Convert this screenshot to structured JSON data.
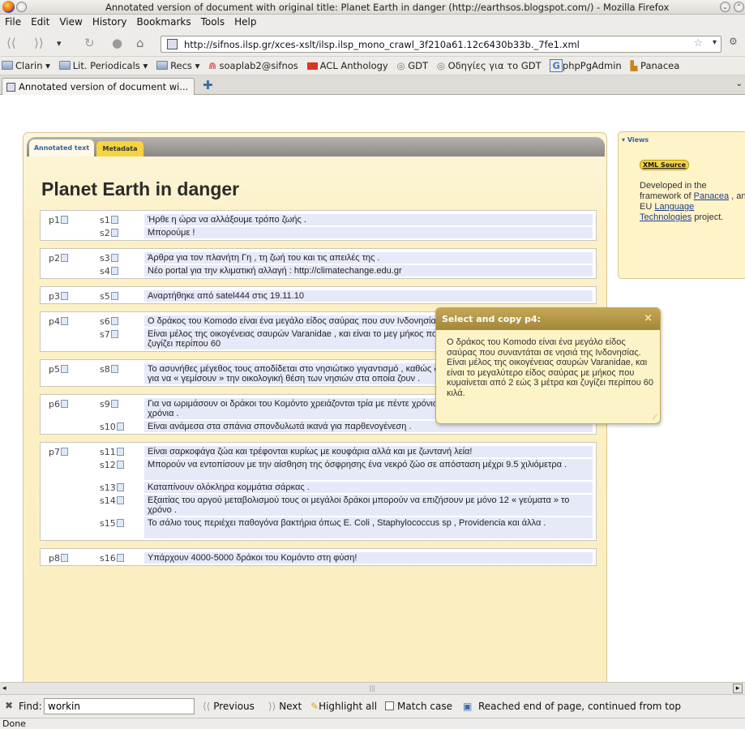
{
  "window": {
    "title": "Annotated version of document with original title: Planet Earth in danger (http://earthsos.blogspot.com/) - Mozilla Firefox"
  },
  "menu": [
    "File",
    "Edit",
    "View",
    "History",
    "Bookmarks",
    "Tools",
    "Help"
  ],
  "url": "http://sifnos.ilsp.gr/xces-xslt/ilsp.ilsp_mono_crawl_3f210a61.12c6430b33b._7fe1.xml",
  "bookmarks": [
    "Clarin",
    "Lit. Periodicals",
    "Recs",
    "soaplab2@sifnos",
    "ACL Anthology",
    "GDT",
    "Οδηγίες για το GDT",
    "phpPgAdmin",
    "Panacea"
  ],
  "tab": {
    "title": "Annotated version of document wi..."
  },
  "page": {
    "tabs": {
      "annotated": "Annotated text",
      "metadata": "Metadata"
    },
    "title": "Planet Earth in danger",
    "paragraphs": [
      {
        "label": "p1",
        "sentences": [
          {
            "label": "s1",
            "text": "Ήρθε η ώρα να αλλάξουμε τρόπο ζωής ."
          },
          {
            "label": "s2",
            "text": "Μπορούμε !"
          }
        ]
      },
      {
        "label": "p2",
        "sentences": [
          {
            "label": "s3",
            "text": "Άρθρα για τον πλανήτη Γη , τη ζωή του και τις απειλές της ."
          },
          {
            "label": "s4",
            "text": "Νέο portal για την κλιματική αλλαγή : http://climatechange.edu.gr"
          }
        ]
      },
      {
        "label": "p3",
        "sentences": [
          {
            "label": "s5",
            "text": "Αναρτήθηκε από satel444 στις 19.11.10"
          }
        ]
      },
      {
        "label": "p4",
        "sentences": [
          {
            "label": "s6",
            "text": "Ο δράκος του Komodo είναι ένα μεγάλο είδος σαύρας που συν Ινδονησίας ."
          },
          {
            "label": "s7",
            "text": "Είναι μέλος της οικογένειας σαυρών Varanidae , και είναι το μεγ μήκος που κυμαίνεται από 2 εώς 3 μέτρα και ζυγίζει περίπου 60"
          }
        ]
      },
      {
        "label": "p5",
        "sentences": [
          {
            "label": "s8",
            "text": "Το ασυνήθες μέγεθος τους αποδίδεται στο νησιώτικο γιγαντισμό , καθώς δεν υπάρχουν άλλα σαρκοφάγα ζώα για να « γεμίσουν » την οικολογική θέση των νησιών στα οποία ζουν ."
          }
        ]
      },
      {
        "label": "p6",
        "sentences": [
          {
            "label": "s9",
            "text": "Για να ωριμάσουν οι δράκοι του Κομόντο χρειάζονται τρία με πέντε χρόνια ενώ μπορούν να ζήσουν εώς και 50 χρόνια ."
          },
          {
            "label": "s10",
            "text": "Είναι ανάμεσα στα σπάνια σπονδυλωτά ικανά για παρθενογένεση ."
          }
        ]
      },
      {
        "label": "p7",
        "sentences": [
          {
            "label": "s11",
            "text": "Είναι σαρκοφάγα ζώα και τρέφονται κυρίως με κουφάρια αλλά και με ζωντανή λεία!"
          },
          {
            "label": "s12",
            "text": "Μπορούν να εντοπίσουν με την αίσθηση της όσφρησης ένα νεκρό ζώο σε απόσταση μέχρι 9.5 χιλιόμετρα ."
          },
          {
            "label": "s13",
            "text": "Καταπίνουν ολόκληρα κομμάτια σάρκας ."
          },
          {
            "label": "s14",
            "text": "Εξαιτίας του αργού μεταβολισμού τους οι μεγάλοι δράκοι μπορούν να επιζήσουν με μόνο 12 « γεύματα » το χρόνο ."
          },
          {
            "label": "s15",
            "text": "Το σάλιο τους περιέχει παθογόνα βακτήρια όπως E. Coli , Staphylococcus sp , Providencia και άλλα ."
          }
        ]
      },
      {
        "label": "p8",
        "sentences": [
          {
            "label": "s16",
            "text": "Υπάρχουν 4000-5000 δράκοι του Κομόντο στη φύση!"
          }
        ]
      }
    ]
  },
  "views": {
    "header": "Views",
    "xml_source": "XML Source",
    "text_before": "Developed in the framework of ",
    "link1": "Panacea",
    "text_mid": " , an EU ",
    "link2": "Language Technologies",
    "text_after": " project."
  },
  "popup": {
    "title": "Select and copy p4:",
    "close": "×",
    "body": "Ο δράκος του Komodo είναι ένα μεγάλο είδος σαύρας που συναντάται σε νησιά της Ινδονησίας. Είναι μέλος της οικογένειας σαυρών Varanidae, και είναι το μεγαλύτερο είδος σαύρας με μήκος που κυμαίνεται από 2 εώς 3 μέτρα και ζυγίζει περίπου 60 κιλά."
  },
  "find": {
    "label": "Find:",
    "value": "workin",
    "previous": "Previous",
    "next": "Next",
    "highlight": "Highlight all",
    "matchcase": "Match case",
    "status": "Reached end of page, continued from top"
  },
  "status": "Done"
}
